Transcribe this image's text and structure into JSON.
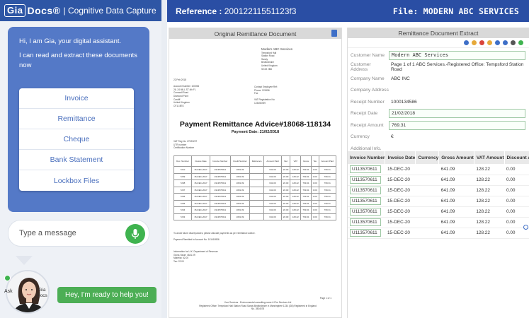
{
  "brand": {
    "logo": "Gia",
    "product": "Docs®",
    "tagline": "| Cognitive Data Capture"
  },
  "chat": {
    "greeting": "Hi, I am Gia, your digital assistant.",
    "intro": "I can read and extract these documents now",
    "options": [
      "Invoice",
      "Remittance",
      "Cheque",
      "Bank Statement",
      "Lockbox Files"
    ],
    "input_placeholder": "Type a message",
    "ask_label": "Ask",
    "bot_label_1": "Gia",
    "bot_label_2": "Docs",
    "bot_message": "Hey, I'm ready to help you!"
  },
  "header": {
    "reference_label": "Reference :",
    "reference_value": "20012211551123f3",
    "file_label": "File:",
    "file_value": "MODERN ABC SERVICES"
  },
  "original_doc": {
    "title": "Original Remittance Document",
    "sender": "Modern ABC Services",
    "sender_lines": [
      "Tempsford Hall",
      "Station Road",
      "Sandy",
      "Bedfordshire",
      "United Kingdom",
      "SG19 2BD"
    ],
    "account_lines": [
      "22 Feb 2018",
      "",
      "Account Number: 100054",
      "26, 24 MILL ST 4th FL",
      "Cornwall Road",
      "Diamond Point",
      "Cardiff",
      "United Kingdom",
      "CF11 8ES"
    ],
    "contact_lines": [
      "Contact Employee Ref:",
      "Phone: 123456",
      "Fax",
      "",
      "VAT Registration No:",
      "123456789"
    ],
    "payment_title": "Payment Remittance Advice#18068-118134",
    "payment_date": "Payment Date: 21/02/2018",
    "vat_lines": [
      "VAT Reg No. 27023227",
      "UTR number",
      "Certification Number"
    ],
    "table_header": [
      "Doc. Number",
      "Invoice Date",
      "Invoice Number",
      "Credit Number",
      "Reference",
      "Amount Paid",
      "Net",
      "VAT",
      "Gross",
      "Tax",
      "Amount Paid"
    ],
    "table_rows": [
      [
        "7210",
        "15-DEC-2017",
        "U113570611",
        "1081.09",
        "",
        "641.09",
        "20.00",
        "128.22",
        "769.31",
        "0.00",
        "769.31"
      ],
      [
        "7209",
        "15-DEC-2017",
        "U113570611",
        "1081.09",
        "",
        "641.09",
        "20.00",
        "128.22",
        "769.31",
        "0.00",
        "769.31"
      ],
      [
        "7208",
        "15-DEC-2017",
        "U113570611",
        "1081.09",
        "",
        "641.09",
        "20.00",
        "128.22",
        "769.31",
        "0.00",
        "769.31"
      ],
      [
        "7207",
        "15-DEC-2017",
        "U113570611",
        "1081.09",
        "",
        "641.09",
        "20.00",
        "128.22",
        "769.31",
        "0.00",
        "769.31"
      ],
      [
        "7206",
        "15-DEC-2017",
        "U113570611",
        "1081.09",
        "",
        "641.09",
        "20.00",
        "128.22",
        "769.31",
        "0.00",
        "769.31"
      ],
      [
        "7205",
        "15-DEC-2017",
        "U113570611",
        "1081.09",
        "",
        "641.09",
        "20.00",
        "128.22",
        "769.31",
        "0.00",
        "769.31"
      ],
      [
        "7204",
        "15-DEC-2017",
        "U113570611",
        "1081.09",
        "",
        "641.09",
        "20.00",
        "128.22",
        "769.31",
        "0.00",
        "769.31"
      ],
      [
        "7203",
        "15-DEC-2017",
        "U113570611",
        "1081.09",
        "",
        "641.09",
        "20.00",
        "128.22",
        "769.31",
        "0.00",
        "769.31"
      ]
    ],
    "footer1": "To avoid future discrepancies, please allocate payments as per remittance advice.",
    "footer1b": "Payment Remitted to Account No. 101418936",
    "footer2_lines": [
      "Information for U.K. Department of Revenue:",
      "Gross Value: 4641.09",
      "Material: 62.00",
      "Tax: 22.00"
    ],
    "page_no": "Page 1 of 1",
    "footer3_lines": [
      "Your Services - Environmental consulting name & Fire Services Ltd",
      "Registered Office: Tempsford Hall Station Road Sandy Bedfordshire in Manningtree 1234 (GB) Registered in England No. 2834578"
    ]
  },
  "extract": {
    "title": "Remittance Document Extract",
    "fields": [
      {
        "label": "Customer Name",
        "value": "Modern ABC Services",
        "boxed": true,
        "mono": true
      },
      {
        "label": "Customer Address",
        "value": "Page 1 of 1 ABC Services.-Registered Office: Tempsford Station Road",
        "boxed": false,
        "mono": false
      },
      {
        "label": "Company Name",
        "value": "ABC INC",
        "boxed": false,
        "mono": false
      },
      {
        "label": "Company Address",
        "value": "",
        "boxed": false,
        "mono": false
      },
      {
        "label": "Receipt Number",
        "value": "1000134586",
        "boxed": false,
        "mono": false
      },
      {
        "label": "Receipt Date",
        "value": "21/02/2018",
        "boxed": true,
        "mono": false
      },
      {
        "label": "Receipt Amount",
        "value": "769.31",
        "boxed": true,
        "mono": false
      },
      {
        "label": "Currency",
        "value": "€",
        "boxed": false,
        "mono": false
      },
      {
        "label": "Additional Info.",
        "value": "",
        "boxed": false,
        "mono": false
      }
    ],
    "columns": [
      "Invoice Number",
      "Invoice Date",
      "Currency",
      "Gross Amount",
      "VAT Amount",
      "Discount A"
    ],
    "rows": [
      [
        "U113570611",
        "15-DEC-20",
        "",
        "641.09",
        "128.22",
        "0.00"
      ],
      [
        "U113570611",
        "15-DEC-20",
        "",
        "641.09",
        "128.22",
        "0.00"
      ],
      [
        "U113570611",
        "15-DEC-20",
        "",
        "641.09",
        "128.22",
        "0.00"
      ],
      [
        "U113570611",
        "15-DEC-20",
        "",
        "641.09",
        "128.22",
        "0.00"
      ],
      [
        "U113570611",
        "15-DEC-20",
        "",
        "641.09",
        "128.22",
        "0.00"
      ],
      [
        "U113570611",
        "15-DEC-20",
        "",
        "641.09",
        "128.22",
        "0.00"
      ],
      [
        "U113570611",
        "15-DEC-20",
        "",
        "641.09",
        "128.22",
        "0.00"
      ]
    ],
    "toolbar_icons": [
      "share-icon",
      "search-icon",
      "reject-icon",
      "refresh-icon",
      "edit-icon",
      "save-icon",
      "cloud-icon",
      "accept-icon"
    ],
    "toolbar_colors": [
      "#3e6fc7",
      "#e6a93a",
      "#d9443b",
      "#e6a93a",
      "#3e6fc7",
      "#3e6fc7",
      "#555555",
      "#3fb34f"
    ]
  }
}
